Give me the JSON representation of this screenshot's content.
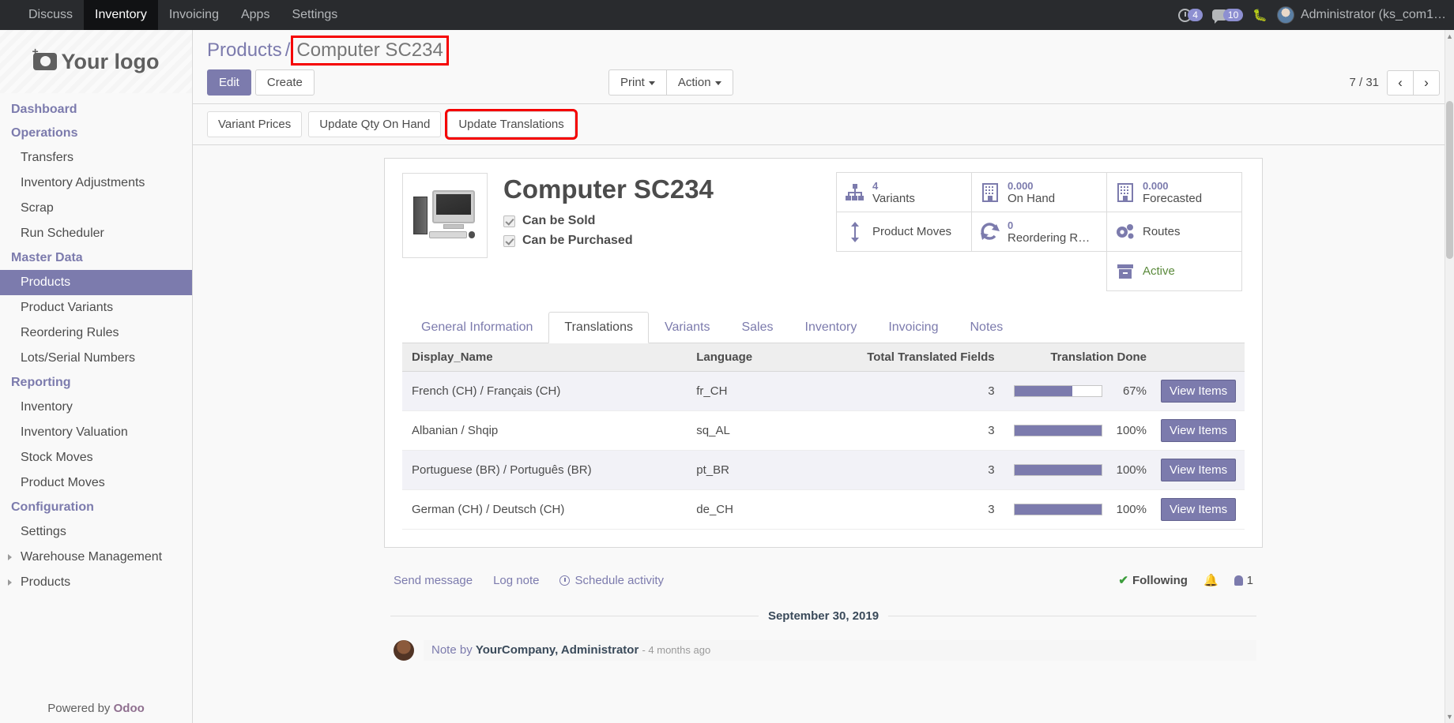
{
  "navbar": {
    "apps": [
      {
        "label": "Discuss",
        "active": false
      },
      {
        "label": "Inventory",
        "active": true
      },
      {
        "label": "Invoicing",
        "active": false
      },
      {
        "label": "Apps",
        "active": false
      },
      {
        "label": "Settings",
        "active": false
      }
    ],
    "activity_count": "4",
    "messages_count": "10",
    "debug_icon": "bug-icon",
    "user_name": "Administrator (ks_com1…"
  },
  "sidebar": {
    "logo_text": "Your logo",
    "groups": [
      {
        "header": "Dashboard",
        "items": []
      },
      {
        "header": "Operations",
        "items": [
          {
            "label": "Transfers",
            "selected": false,
            "caret": false
          },
          {
            "label": "Inventory Adjustments",
            "selected": false,
            "caret": false
          },
          {
            "label": "Scrap",
            "selected": false,
            "caret": false
          },
          {
            "label": "Run Scheduler",
            "selected": false,
            "caret": false
          }
        ]
      },
      {
        "header": "Master Data",
        "items": [
          {
            "label": "Products",
            "selected": true,
            "caret": false
          },
          {
            "label": "Product Variants",
            "selected": false,
            "caret": false
          },
          {
            "label": "Reordering Rules",
            "selected": false,
            "caret": false
          },
          {
            "label": "Lots/Serial Numbers",
            "selected": false,
            "caret": false
          }
        ]
      },
      {
        "header": "Reporting",
        "items": [
          {
            "label": "Inventory",
            "selected": false,
            "caret": false
          },
          {
            "label": "Inventory Valuation",
            "selected": false,
            "caret": false
          },
          {
            "label": "Stock Moves",
            "selected": false,
            "caret": false
          },
          {
            "label": "Product Moves",
            "selected": false,
            "caret": false
          }
        ]
      },
      {
        "header": "Configuration",
        "items": [
          {
            "label": "Settings",
            "selected": false,
            "caret": false
          },
          {
            "label": "Warehouse Management",
            "selected": false,
            "caret": true
          },
          {
            "label": "Products",
            "selected": false,
            "caret": true
          }
        ]
      }
    ],
    "footer_prefix": "Powered by",
    "footer_brand": "Odoo"
  },
  "control_panel": {
    "breadcrumb_parent": "Products",
    "breadcrumb_sep": "/",
    "breadcrumb_current": "Computer SC234",
    "edit_label": "Edit",
    "create_label": "Create",
    "print_label": "Print",
    "action_label": "Action",
    "pager_text": "7 / 31",
    "prev_icon": "‹",
    "next_icon": "›"
  },
  "object_buttons": [
    {
      "label": "Variant Prices",
      "highlight": false
    },
    {
      "label": "Update Qty On Hand",
      "highlight": false
    },
    {
      "label": "Update Translations",
      "highlight": true
    }
  ],
  "product": {
    "image_alt": "computer-product-image",
    "title": "Computer SC234",
    "checkboxes": [
      {
        "label": "Can be Sold",
        "checked": true
      },
      {
        "label": "Can be Purchased",
        "checked": true
      }
    ],
    "stats": [
      {
        "value": "4",
        "label": "Variants",
        "icon": "hierarchy-icon",
        "green": false
      },
      {
        "value": "0.000",
        "label": "On Hand",
        "icon": "building-icon",
        "green": false
      },
      {
        "value": "0.000",
        "label": "Forecasted",
        "icon": "building-icon",
        "green": false
      },
      {
        "value": "",
        "label": "Product Moves",
        "icon": "arrows-vertical-icon",
        "green": false
      },
      {
        "value": "0",
        "label": "Reordering R…",
        "icon": "refresh-icon",
        "green": false
      },
      {
        "value": "",
        "label": "Routes",
        "icon": "gears-icon",
        "green": false
      },
      {
        "value": "",
        "label": "",
        "icon": "",
        "green": false
      },
      {
        "value": "",
        "label": "",
        "icon": "",
        "green": false
      },
      {
        "value": "",
        "label": "Active",
        "icon": "archive-icon",
        "green": true
      }
    ]
  },
  "tabs": [
    {
      "label": "General Information",
      "active": false
    },
    {
      "label": "Translations",
      "active": true
    },
    {
      "label": "Variants",
      "active": false
    },
    {
      "label": "Sales",
      "active": false
    },
    {
      "label": "Inventory",
      "active": false
    },
    {
      "label": "Invoicing",
      "active": false
    },
    {
      "label": "Notes",
      "active": false
    }
  ],
  "translations_table": {
    "columns": [
      "Display_Name",
      "Language",
      "Total Translated Fields",
      "Translation Done",
      ""
    ],
    "action_label": "View Items",
    "rows": [
      {
        "display_name": "French (CH) / Français (CH)",
        "language": "fr_CH",
        "total_fields": "3",
        "percent": 67,
        "percent_label": "67%",
        "alt": true,
        "highlight": false
      },
      {
        "display_name": "Albanian / Shqip",
        "language": "sq_AL",
        "total_fields": "3",
        "percent": 100,
        "percent_label": "100%",
        "alt": false,
        "highlight": false
      },
      {
        "display_name": "Portuguese (BR) / Português (BR)",
        "language": "pt_BR",
        "total_fields": "3",
        "percent": 100,
        "percent_label": "100%",
        "alt": true,
        "highlight": false
      },
      {
        "display_name": "German (CH) / Deutsch (CH)",
        "language": "de_CH",
        "total_fields": "3",
        "percent": 100,
        "percent_label": "100%",
        "alt": false,
        "highlight": true
      }
    ]
  },
  "chatter": {
    "send_message": "Send message",
    "log_note": "Log note",
    "schedule_activity": "Schedule activity",
    "following_check": "✔",
    "following_label": "Following",
    "bell_icon": "bell-icon",
    "followers_count": "1",
    "date_separator": "September 30, 2019",
    "message_author_prefix": "Note by",
    "message_author": "YourCompany, Administrator",
    "message_time": "- 4 months ago"
  },
  "colors": {
    "accent": "#7c7bad",
    "navbar_bg": "#292b2e",
    "highlight": "#f50000",
    "green": "#5b8a3c"
  }
}
